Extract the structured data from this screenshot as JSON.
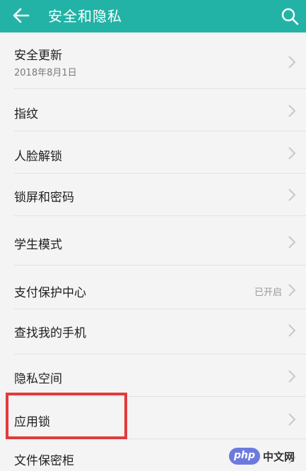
{
  "app_bar": {
    "title": "安全和隐私",
    "back_icon": "back-arrow-icon",
    "search_icon": "search-icon",
    "color": "#22b3a6"
  },
  "items": [
    {
      "label": "安全更新",
      "sub": "2018年8月1日"
    },
    {
      "label": "指纹"
    },
    {
      "label": "人脸解锁"
    },
    {
      "label": "锁屏和密码"
    },
    {
      "label": "学生模式"
    },
    {
      "label": "支付保护中心",
      "status": "已开启"
    },
    {
      "label": "查找我的手机"
    },
    {
      "label": "隐私空间"
    },
    {
      "label": "应用锁"
    },
    {
      "label": "文件保密柜"
    }
  ],
  "highlight_color": "#e23a3a",
  "watermark": {
    "badge": "php",
    "text": "中文网"
  }
}
